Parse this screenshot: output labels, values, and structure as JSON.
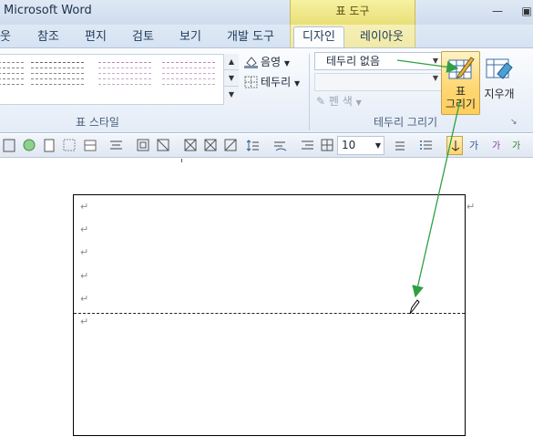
{
  "window": {
    "title": "Microsoft Word",
    "context_tab_group": "표 도구",
    "minimize_icon": "minimize-icon"
  },
  "tabs": [
    {
      "label": "웃"
    },
    {
      "label": "참조"
    },
    {
      "label": "편지"
    },
    {
      "label": "검토"
    },
    {
      "label": "보기"
    },
    {
      "label": "개발 도구"
    },
    {
      "label": "디자인",
      "active": true
    },
    {
      "label": "레이아웃"
    }
  ],
  "ribbon": {
    "table_styles_group_label": "표 스타일",
    "shading_label": "음영",
    "borders_label": "테두리",
    "borders_group_label": "테두리 그리기",
    "border_style_value": "테두리 없음",
    "pen_color_label": "펜 색",
    "draw_table_label_line1": "표",
    "draw_table_label_line2": "그리기",
    "eraser_label": "지우개"
  },
  "toolbar": {
    "font_size_value": "10"
  },
  "document": {
    "paragraph_mark": "↵"
  },
  "colors": {
    "accent_arrow": "#2ea043",
    "context_tab": "#efe48a",
    "active_button": "#ffd775"
  }
}
